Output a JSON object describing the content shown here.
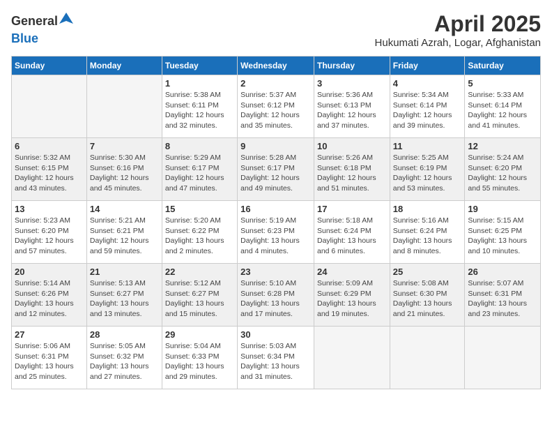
{
  "logo": {
    "general": "General",
    "blue": "Blue"
  },
  "header": {
    "month": "April 2025",
    "location": "Hukumati Azrah, Logar, Afghanistan"
  },
  "columns": [
    "Sunday",
    "Monday",
    "Tuesday",
    "Wednesday",
    "Thursday",
    "Friday",
    "Saturday"
  ],
  "weeks": [
    [
      {
        "day": "",
        "sunrise": "",
        "sunset": "",
        "daylight": ""
      },
      {
        "day": "",
        "sunrise": "",
        "sunset": "",
        "daylight": ""
      },
      {
        "day": "1",
        "sunrise": "Sunrise: 5:38 AM",
        "sunset": "Sunset: 6:11 PM",
        "daylight": "Daylight: 12 hours and 32 minutes."
      },
      {
        "day": "2",
        "sunrise": "Sunrise: 5:37 AM",
        "sunset": "Sunset: 6:12 PM",
        "daylight": "Daylight: 12 hours and 35 minutes."
      },
      {
        "day": "3",
        "sunrise": "Sunrise: 5:36 AM",
        "sunset": "Sunset: 6:13 PM",
        "daylight": "Daylight: 12 hours and 37 minutes."
      },
      {
        "day": "4",
        "sunrise": "Sunrise: 5:34 AM",
        "sunset": "Sunset: 6:14 PM",
        "daylight": "Daylight: 12 hours and 39 minutes."
      },
      {
        "day": "5",
        "sunrise": "Sunrise: 5:33 AM",
        "sunset": "Sunset: 6:14 PM",
        "daylight": "Daylight: 12 hours and 41 minutes."
      }
    ],
    [
      {
        "day": "6",
        "sunrise": "Sunrise: 5:32 AM",
        "sunset": "Sunset: 6:15 PM",
        "daylight": "Daylight: 12 hours and 43 minutes."
      },
      {
        "day": "7",
        "sunrise": "Sunrise: 5:30 AM",
        "sunset": "Sunset: 6:16 PM",
        "daylight": "Daylight: 12 hours and 45 minutes."
      },
      {
        "day": "8",
        "sunrise": "Sunrise: 5:29 AM",
        "sunset": "Sunset: 6:17 PM",
        "daylight": "Daylight: 12 hours and 47 minutes."
      },
      {
        "day": "9",
        "sunrise": "Sunrise: 5:28 AM",
        "sunset": "Sunset: 6:17 PM",
        "daylight": "Daylight: 12 hours and 49 minutes."
      },
      {
        "day": "10",
        "sunrise": "Sunrise: 5:26 AM",
        "sunset": "Sunset: 6:18 PM",
        "daylight": "Daylight: 12 hours and 51 minutes."
      },
      {
        "day": "11",
        "sunrise": "Sunrise: 5:25 AM",
        "sunset": "Sunset: 6:19 PM",
        "daylight": "Daylight: 12 hours and 53 minutes."
      },
      {
        "day": "12",
        "sunrise": "Sunrise: 5:24 AM",
        "sunset": "Sunset: 6:20 PM",
        "daylight": "Daylight: 12 hours and 55 minutes."
      }
    ],
    [
      {
        "day": "13",
        "sunrise": "Sunrise: 5:23 AM",
        "sunset": "Sunset: 6:20 PM",
        "daylight": "Daylight: 12 hours and 57 minutes."
      },
      {
        "day": "14",
        "sunrise": "Sunrise: 5:21 AM",
        "sunset": "Sunset: 6:21 PM",
        "daylight": "Daylight: 12 hours and 59 minutes."
      },
      {
        "day": "15",
        "sunrise": "Sunrise: 5:20 AM",
        "sunset": "Sunset: 6:22 PM",
        "daylight": "Daylight: 13 hours and 2 minutes."
      },
      {
        "day": "16",
        "sunrise": "Sunrise: 5:19 AM",
        "sunset": "Sunset: 6:23 PM",
        "daylight": "Daylight: 13 hours and 4 minutes."
      },
      {
        "day": "17",
        "sunrise": "Sunrise: 5:18 AM",
        "sunset": "Sunset: 6:24 PM",
        "daylight": "Daylight: 13 hours and 6 minutes."
      },
      {
        "day": "18",
        "sunrise": "Sunrise: 5:16 AM",
        "sunset": "Sunset: 6:24 PM",
        "daylight": "Daylight: 13 hours and 8 minutes."
      },
      {
        "day": "19",
        "sunrise": "Sunrise: 5:15 AM",
        "sunset": "Sunset: 6:25 PM",
        "daylight": "Daylight: 13 hours and 10 minutes."
      }
    ],
    [
      {
        "day": "20",
        "sunrise": "Sunrise: 5:14 AM",
        "sunset": "Sunset: 6:26 PM",
        "daylight": "Daylight: 13 hours and 12 minutes."
      },
      {
        "day": "21",
        "sunrise": "Sunrise: 5:13 AM",
        "sunset": "Sunset: 6:27 PM",
        "daylight": "Daylight: 13 hours and 13 minutes."
      },
      {
        "day": "22",
        "sunrise": "Sunrise: 5:12 AM",
        "sunset": "Sunset: 6:27 PM",
        "daylight": "Daylight: 13 hours and 15 minutes."
      },
      {
        "day": "23",
        "sunrise": "Sunrise: 5:10 AM",
        "sunset": "Sunset: 6:28 PM",
        "daylight": "Daylight: 13 hours and 17 minutes."
      },
      {
        "day": "24",
        "sunrise": "Sunrise: 5:09 AM",
        "sunset": "Sunset: 6:29 PM",
        "daylight": "Daylight: 13 hours and 19 minutes."
      },
      {
        "day": "25",
        "sunrise": "Sunrise: 5:08 AM",
        "sunset": "Sunset: 6:30 PM",
        "daylight": "Daylight: 13 hours and 21 minutes."
      },
      {
        "day": "26",
        "sunrise": "Sunrise: 5:07 AM",
        "sunset": "Sunset: 6:31 PM",
        "daylight": "Daylight: 13 hours and 23 minutes."
      }
    ],
    [
      {
        "day": "27",
        "sunrise": "Sunrise: 5:06 AM",
        "sunset": "Sunset: 6:31 PM",
        "daylight": "Daylight: 13 hours and 25 minutes."
      },
      {
        "day": "28",
        "sunrise": "Sunrise: 5:05 AM",
        "sunset": "Sunset: 6:32 PM",
        "daylight": "Daylight: 13 hours and 27 minutes."
      },
      {
        "day": "29",
        "sunrise": "Sunrise: 5:04 AM",
        "sunset": "Sunset: 6:33 PM",
        "daylight": "Daylight: 13 hours and 29 minutes."
      },
      {
        "day": "30",
        "sunrise": "Sunrise: 5:03 AM",
        "sunset": "Sunset: 6:34 PM",
        "daylight": "Daylight: 13 hours and 31 minutes."
      },
      {
        "day": "",
        "sunrise": "",
        "sunset": "",
        "daylight": ""
      },
      {
        "day": "",
        "sunrise": "",
        "sunset": "",
        "daylight": ""
      },
      {
        "day": "",
        "sunrise": "",
        "sunset": "",
        "daylight": ""
      }
    ]
  ]
}
